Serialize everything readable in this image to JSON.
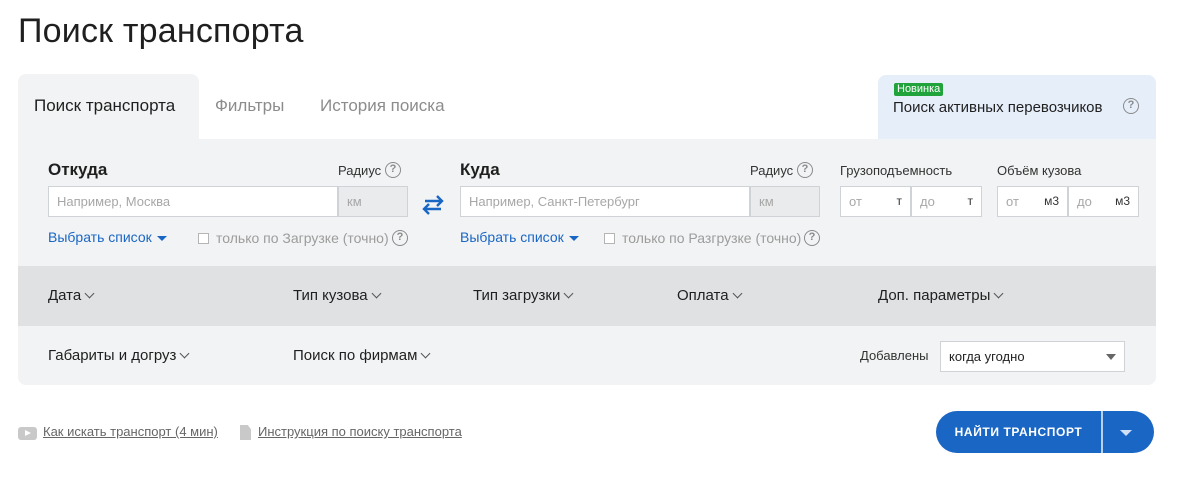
{
  "page": {
    "title": "Поиск транспорта"
  },
  "tabs": {
    "active": "Поиск транспорта",
    "filters": "Фильтры",
    "history": "История поиска",
    "carriers": {
      "badge": "Новинка",
      "label": "Поиск активных перевозчиков"
    }
  },
  "from": {
    "label": "Откуда",
    "radius_label": "Радиус",
    "placeholder": "Например, Москва",
    "radius_placeholder": "км",
    "select_list": "Выбрать список",
    "only_label": "только по Загрузке (точно)"
  },
  "to": {
    "label": "Куда",
    "radius_label": "Радиус",
    "placeholder": "Например, Санкт-Петербург",
    "radius_placeholder": "км",
    "select_list": "Выбрать список",
    "only_label": "только по Разгрузке (точно)"
  },
  "capacity": {
    "label": "Грузоподъемность",
    "from": "от",
    "to": "до",
    "unit": "т"
  },
  "volume": {
    "label": "Объём кузова",
    "from": "от",
    "to": "до",
    "unit": "м3"
  },
  "filters": {
    "date": "Дата",
    "body_type": "Тип кузова",
    "load_type": "Тип загрузки",
    "payment": "Оплата",
    "extra": "Доп. параметры",
    "dimensions": "Габариты и догруз",
    "firms": "Поиск по фирмам",
    "added_label": "Добавлены",
    "added_value": "когда угодно"
  },
  "help": {
    "video": "Как искать транспорт (4 мин)",
    "instruction": "Инструкция по поиску транспорта"
  },
  "action": {
    "find": "НАЙТИ ТРАНСПОРТ"
  },
  "colors": {
    "accent": "#1a66c4",
    "badge": "#1fa33a",
    "panel_bg": "#f2f3f4",
    "filter_bg": "#dfe1e3"
  }
}
